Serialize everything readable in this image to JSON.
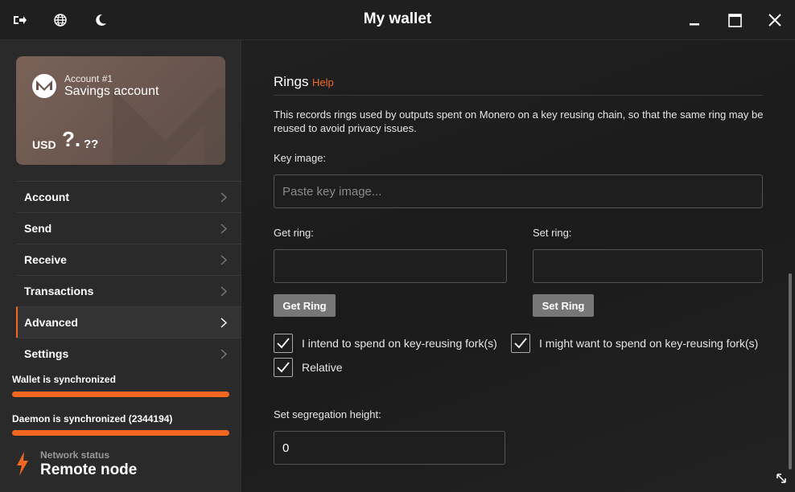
{
  "window": {
    "title": "My wallet",
    "left_icons": [
      "exit-icon",
      "globe-icon",
      "moon-icon"
    ],
    "controls": [
      "minimize-icon",
      "maximize-icon",
      "close-icon"
    ]
  },
  "account_card": {
    "account_number": "Account #1",
    "account_name": "Savings account",
    "currency": "USD",
    "balance_main": "?.",
    "balance_fraction": "??",
    "logo": "monero-logo"
  },
  "menu": [
    {
      "label": "Account",
      "active": false
    },
    {
      "label": "Send",
      "active": false
    },
    {
      "label": "Receive",
      "active": false
    },
    {
      "label": "Transactions",
      "active": false
    },
    {
      "label": "Advanced",
      "active": true
    },
    {
      "label": "Settings",
      "active": false
    }
  ],
  "status": {
    "wallet_sync": "Wallet is synchronized",
    "wallet_progress": 1.0,
    "daemon_sync": "Daemon is synchronized (2344194)",
    "daemon_progress": 1.0,
    "network_label": "Network status",
    "network_value": "Remote node"
  },
  "rings": {
    "title": "Rings",
    "help": "Help",
    "description": "This records rings used by outputs spent on Monero on a key reusing chain, so that the same ring may be reused to avoid privacy issues.",
    "key_image_label": "Key image:",
    "key_image_placeholder": "Paste key image...",
    "key_image_value": "",
    "get_ring_label": "Get ring:",
    "get_ring_value": "",
    "get_ring_button": "Get Ring",
    "set_ring_label": "Set ring:",
    "set_ring_value": "",
    "set_ring_button": "Set Ring",
    "checkbox_intend": "I intend to spend on key-reusing fork(s)",
    "checkbox_intend_checked": true,
    "checkbox_might": "I might want to spend on key-reusing fork(s)",
    "checkbox_might_checked": true,
    "checkbox_relative": "Relative",
    "checkbox_relative_checked": true,
    "segregation_label": "Set segregation height:",
    "segregation_value": "0"
  },
  "colors": {
    "accent": "#f26822",
    "sidebar_bg": "#2a2a2a",
    "main_bg": "#1e1e1e",
    "button_bg": "#777777"
  }
}
